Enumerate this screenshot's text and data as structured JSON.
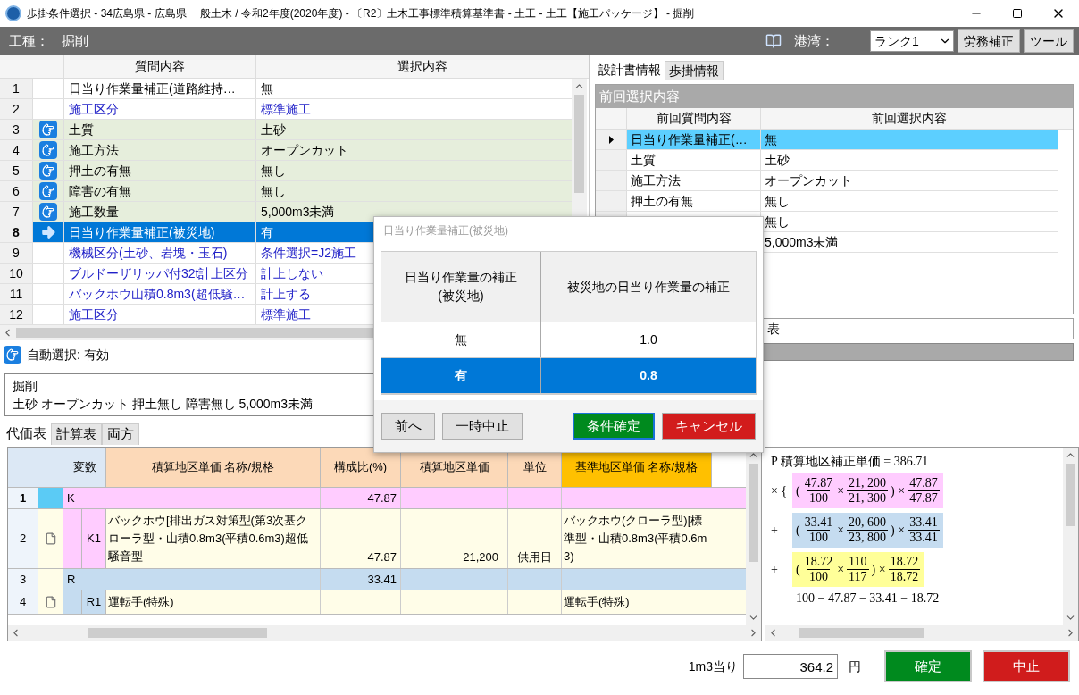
{
  "window": {
    "title": "歩掛条件選択 - 34広島県 - 広島県 一般土木 / 令和2年度(2020年度) - 〔R2〕土木工事標準積算基準書 - 土工 - 土工【施工パッケージ】 - 掘削"
  },
  "toolbar": {
    "label": "工種：",
    "value": "掘削",
    "harbor_label": "港湾：",
    "harbor_select": "ランク1",
    "buttons": [
      "労務補正",
      "ツール"
    ]
  },
  "question_grid": {
    "columns": [
      "質問内容",
      "選択内容"
    ],
    "rows": [
      {
        "no": "1",
        "kind": "plain",
        "question": "日当り作業量補正(道路維持…",
        "answer": "無",
        "selected": false
      },
      {
        "no": "2",
        "kind": "link",
        "question": "施工区分",
        "answer": "標準施工",
        "selected": false
      },
      {
        "no": "3",
        "kind": "auto",
        "question": "土質",
        "answer": "土砂",
        "selected": false
      },
      {
        "no": "4",
        "kind": "auto",
        "question": "施工方法",
        "answer": "オープンカット",
        "selected": false
      },
      {
        "no": "5",
        "kind": "auto",
        "question": "押土の有無",
        "answer": "無し",
        "selected": false
      },
      {
        "no": "6",
        "kind": "auto",
        "question": "障害の有無",
        "answer": "無し",
        "selected": false
      },
      {
        "no": "7",
        "kind": "auto",
        "question": "施工数量",
        "answer": "5,000m3未満",
        "selected": false
      },
      {
        "no": "8",
        "question": "日当り作業量補正(被災地)",
        "answer": "有",
        "selected": true
      },
      {
        "no": "9",
        "kind": "link",
        "question": "機械区分(土砂、岩塊・玉石)",
        "answer": "条件選択=J2施工",
        "selected": false
      },
      {
        "no": "10",
        "kind": "link",
        "question": "ブルドーザリッパ付32t計上区分",
        "answer": "計上しない",
        "selected": false
      },
      {
        "no": "11",
        "kind": "link",
        "question": "バックホウ山積0.8m3(超低騒…",
        "answer": "計上する",
        "selected": false
      },
      {
        "no": "12",
        "kind": "link",
        "question": "施工区分",
        "answer": "標準施工",
        "selected": false
      }
    ]
  },
  "auto_select": "自動選択: 有効",
  "right_tabs": [
    {
      "label": "設計書情報",
      "selected": true
    },
    {
      "label": "歩掛情報",
      "selected": false
    }
  ],
  "previous": {
    "title": "前回選択内容",
    "columns": [
      "前回質問内容",
      "前回選択内容"
    ],
    "rows": [
      {
        "question": "日当り作業量補正(…",
        "answer": "無",
        "selected": true
      },
      {
        "question": "土質",
        "answer": "土砂",
        "selected": false
      },
      {
        "question": "施工方法",
        "answer": "オープンカット",
        "selected": false
      },
      {
        "question": "押土の有無",
        "answer": "無し",
        "selected": false
      },
      {
        "answer": "無し",
        "selected": false
      },
      {
        "answer": "5,000m3未満",
        "selected": false
      }
    ]
  },
  "note_field": "表",
  "summary": {
    "title": "掘削",
    "detail": "土砂 オープンカット 押土無し 障害無し 5,000m3未満"
  },
  "bottom_tabs": [
    {
      "label": "代価表",
      "selected": true
    },
    {
      "label": "計算表",
      "selected": false
    },
    {
      "label": "両方",
      "selected": false
    }
  ],
  "price_table": {
    "columns": [
      "変数",
      "積算地区単価 名称/規格",
      "構成比(%)",
      "積算地区単価",
      "単位",
      "基準地区単価 名称/規格"
    ],
    "rows": [
      {
        "no": "1",
        "kind": "group",
        "var": "K",
        "ratio": "47.87",
        "color": "#ffccff",
        "selected": true
      },
      {
        "no": "2",
        "kind": "item",
        "var": "K1",
        "name": "バックホウ[排出ガス対策型(第3次基クローラ型・山積0.8m3(平積0.6m3)超低騒音型",
        "ratio": "47.87",
        "price": "21,200",
        "unit": "供用日",
        "base_name": "バックホウ(クローラ型)[標準型・山積0.8m3(平積0.6m3)",
        "color": "#ffccff",
        "selected": false
      },
      {
        "no": "3",
        "kind": "group",
        "var": "R",
        "ratio": "33.41",
        "color": "#c5dcf0",
        "selected": false
      },
      {
        "no": "4",
        "kind": "item",
        "var": "R1",
        "name": "運転手(特殊)",
        "base_name": "運転手(特殊)",
        "color": "#c5dcf0",
        "selected": false
      }
    ]
  },
  "formula": {
    "lead": "P 積算地区補正単価 = 386.71",
    "terms": [
      {
        "op": "× {",
        "color": "#ffccff",
        "tokens": [
          {
            "kind": "text",
            "text": "("
          },
          {
            "kind": "frac",
            "num": "47.87",
            "den": "100"
          },
          {
            "kind": "text",
            "text": "×"
          },
          {
            "kind": "frac",
            "num": "21, 200",
            "den": "21, 300"
          },
          {
            "kind": "text",
            "text": ") ×"
          },
          {
            "kind": "frac",
            "num": "47.87",
            "den": "47.87"
          }
        ]
      },
      {
        "op": "+",
        "color": "#c5dcf0",
        "tokens": [
          {
            "kind": "text",
            "text": "("
          },
          {
            "kind": "frac",
            "num": "33.41",
            "den": "100"
          },
          {
            "kind": "text",
            "text": "×"
          },
          {
            "kind": "frac",
            "num": "20, 600",
            "den": "23, 800"
          },
          {
            "kind": "text",
            "text": ") ×"
          },
          {
            "kind": "frac",
            "num": "33.41",
            "den": "33.41"
          }
        ]
      },
      {
        "op": "+",
        "color": "#ffff99",
        "tokens": [
          {
            "kind": "text",
            "text": "("
          },
          {
            "kind": "frac",
            "num": "18.72",
            "den": "100"
          },
          {
            "kind": "text",
            "text": "×"
          },
          {
            "kind": "frac",
            "num": "110",
            "den": "117"
          },
          {
            "kind": "text",
            "text": ") ×"
          },
          {
            "kind": "frac",
            "num": "18.72",
            "den": "18.72"
          }
        ]
      }
    ],
    "tail": "100 − 47.87 − 33.41 − 18.72"
  },
  "total": {
    "label": "1m3当り",
    "value": "364.2",
    "unit": "円"
  },
  "actions": [
    {
      "label": "確定",
      "kind": "confirm"
    },
    {
      "label": "中止",
      "kind": "cancel"
    }
  ],
  "dialog": {
    "title": "日当り作業量補正(被災地)",
    "columns": [
      "日当り作業量の補正(被災地)",
      "被災地の日当り作業量の補正"
    ],
    "options": [
      {
        "label": "無",
        "value": "1.0",
        "selected": false
      },
      {
        "label": "有",
        "value": "0.8",
        "selected": true
      }
    ],
    "buttons": [
      {
        "label": "前へ",
        "kind": "plain"
      },
      {
        "label": "一時中止",
        "kind": "plain"
      },
      {
        "label": "条件確定",
        "kind": "confirm"
      },
      {
        "label": "キャンセル",
        "kind": "cancel"
      }
    ]
  }
}
